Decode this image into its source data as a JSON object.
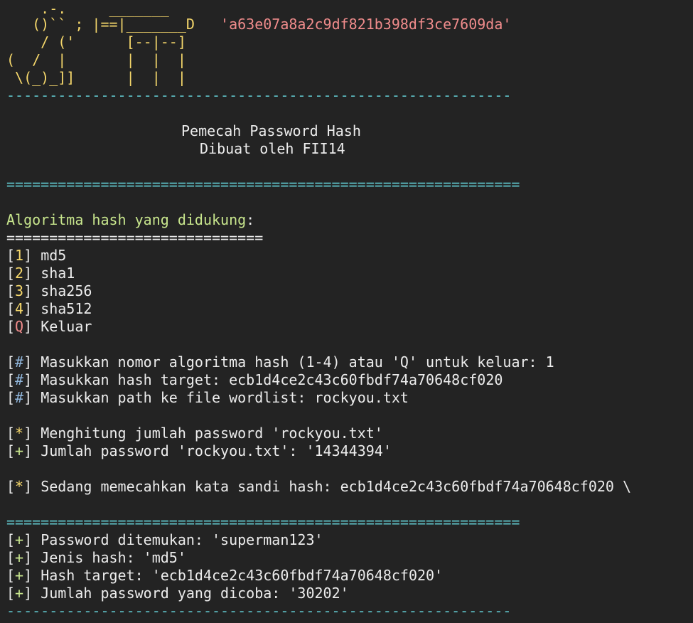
{
  "banner": {
    "art": [
      "    .-.     _______",
      "   ()`` ; |==|_______D",
      "    / ('      [--|--]",
      "(  /  |       |  |  |",
      " \\(_)_]]      |  |  |"
    ],
    "hash_string": "'a63e07a8a2c9df821b398df3ce7609da'"
  },
  "separators": {
    "dash": "-----------------------------------------------------------",
    "equals": "============================================================",
    "short_equals": "=============================="
  },
  "title": {
    "line1": "Pemecah Password Hash",
    "line2": "Dibuat oleh FII14"
  },
  "menu": {
    "heading": "Algoritma hash yang didukung",
    "heading_colon": ":",
    "items": [
      {
        "key": "1",
        "label": "md5"
      },
      {
        "key": "2",
        "label": "sha1"
      },
      {
        "key": "3",
        "label": "sha256"
      },
      {
        "key": "4",
        "label": "sha512"
      },
      {
        "key": "Q",
        "label": "Keluar"
      }
    ]
  },
  "prompts": [
    {
      "marker": "#",
      "text": "Masukkan nomor algoritma hash (1-4) atau 'Q' untuk keluar: 1"
    },
    {
      "marker": "#",
      "text": "Masukkan hash target: ecb1d4ce2c43c60fbdf74a70648cf020"
    },
    {
      "marker": "#",
      "text": "Masukkan path ke file wordlist: rockyou.txt"
    }
  ],
  "counting": [
    {
      "marker": "*",
      "text": "Menghitung jumlah password 'rockyou.txt'"
    },
    {
      "marker": "+",
      "text": "Jumlah password 'rockyou.txt': '14344394'"
    }
  ],
  "cracking": {
    "marker": "*",
    "text": "Sedang memecahkan kata sandi hash: ecb1d4ce2c43c60fbdf74a70648cf020 \\"
  },
  "results": [
    {
      "marker": "+",
      "text": "Password ditemukan: 'superman123'"
    },
    {
      "marker": "+",
      "text": "Jenis hash: 'md5'"
    },
    {
      "marker": "+",
      "text": "Hash target: 'ecb1d4ce2c43c60fbdf74a70648cf020'"
    },
    {
      "marker": "+",
      "text": "Jumlah password yang dicoba: '30202'"
    }
  ],
  "colors": {
    "background": "#232323",
    "text": "#ececec",
    "banner": "#f5d76b",
    "hash_string": "#f08c8c",
    "separator": "#5fc3c9",
    "heading": "#c8e68d",
    "prompt_marker": "#8fb4d9"
  }
}
